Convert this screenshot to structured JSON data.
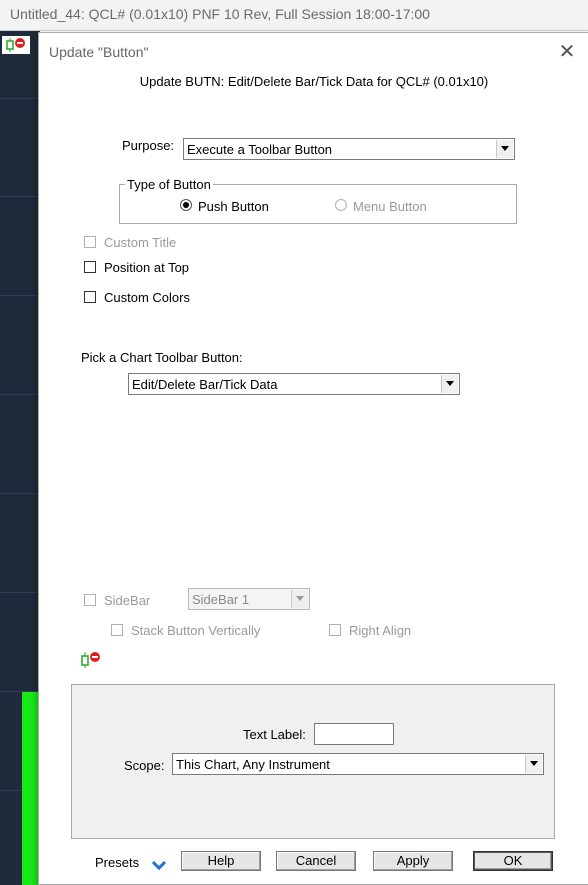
{
  "app": {
    "window_title": "Untitled_44: QCL# (0.01x10) PNF 10 Rev, Full Session 18:00-17:00"
  },
  "dialog": {
    "title": "Update \"Button\"",
    "close_glyph": "✕",
    "subtitle": "Update BUTN: Edit/Delete Bar/Tick Data for QCL# (0.01x10)",
    "purpose": {
      "label": "Purpose:",
      "value": "Execute a Toolbar Button"
    },
    "type_of_button": {
      "legend": "Type of Button",
      "options": [
        "Push Button",
        "Menu Button"
      ],
      "selected": "Push Button"
    },
    "checkboxes": {
      "custom_title": "Custom Title",
      "position_at_top": "Position at Top",
      "custom_colors": "Custom Colors"
    },
    "toolbar_button": {
      "label": "Pick a Chart Toolbar Button:",
      "value": "Edit/Delete Bar/Tick Data"
    },
    "sidebar": {
      "label": "SideBar",
      "value": "SideBar 1",
      "stack_vertically": "Stack Button Vertically",
      "right_align": "Right Align"
    },
    "text_label": {
      "label": "Text Label:",
      "value": ""
    },
    "scope": {
      "label": "Scope:",
      "value": "This Chart, Any Instrument"
    },
    "footer": {
      "presets": "Presets",
      "help": "Help",
      "cancel": "Cancel",
      "apply": "Apply",
      "ok": "OK"
    }
  },
  "colors": {
    "chart_background": "#1f2a3a",
    "volume_bar_green": "#18e818",
    "presets_arrow_blue": "#1e73d2",
    "icon_red": "#e02020",
    "icon_green": "#22aa22"
  },
  "icons": [
    "candlestick-delete-icon",
    "close-icon",
    "chevron-down-icon"
  ]
}
